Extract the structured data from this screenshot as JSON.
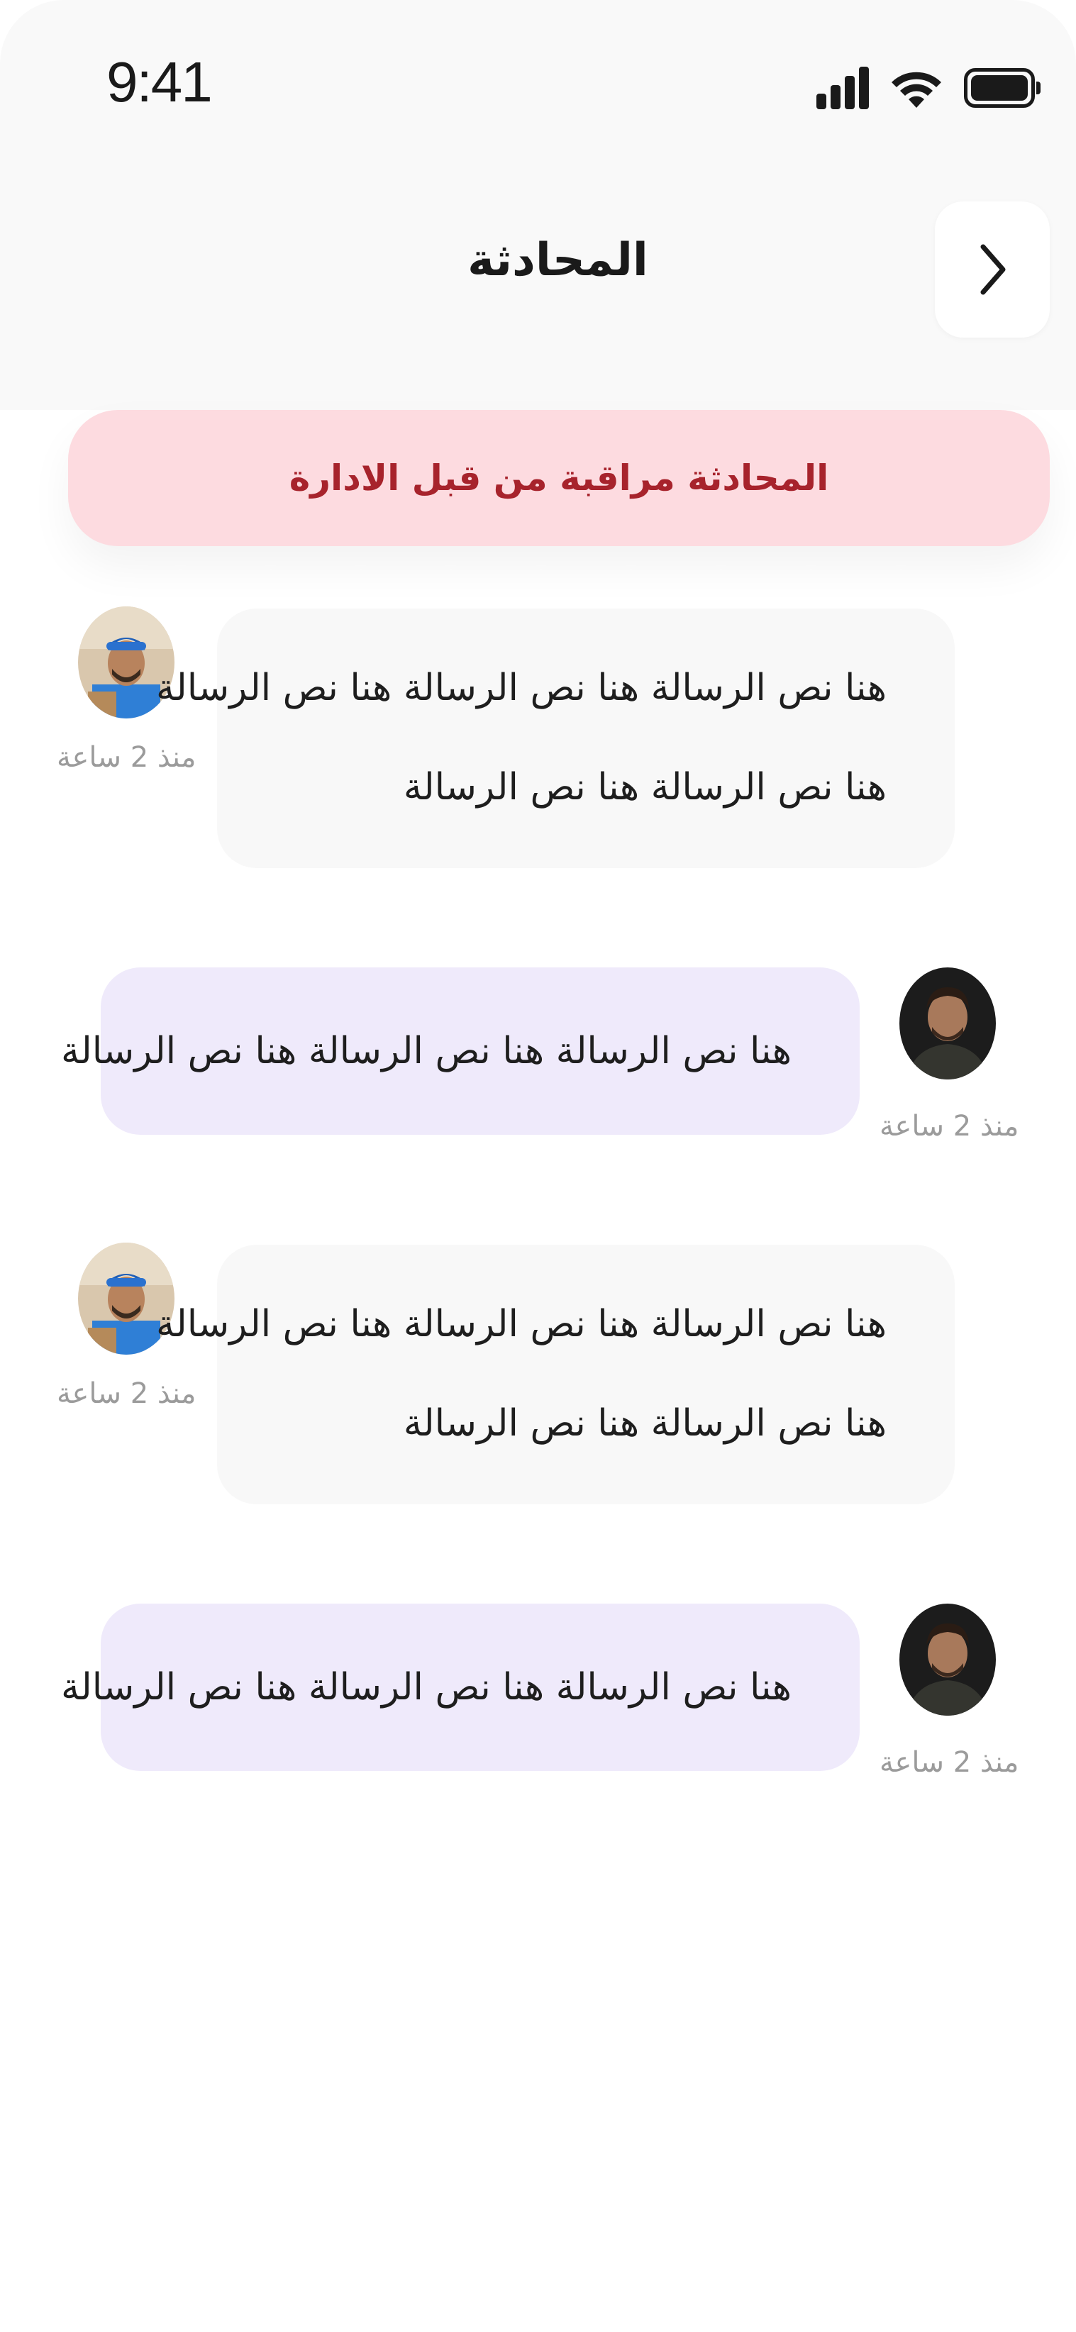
{
  "status_bar": {
    "time": "9:41",
    "icons": [
      "signal-icon",
      "wifi-icon",
      "battery-icon"
    ]
  },
  "header": {
    "title": "المحادثة",
    "back_icon": "chevron-right-icon"
  },
  "banner": {
    "text": "المحادثة مراقبة من قبل الادارة",
    "background": "#fddbe0",
    "color": "#a7232c"
  },
  "colors": {
    "received_bubble": "#f8f8f8",
    "sent_bubble": "#efeafb",
    "timestamp": "#9b9b9b"
  },
  "messages": [
    {
      "direction": "received",
      "avatar": "delivery-person-avatar",
      "lines": [
        "هنا نص الرسالة هنا نص الرسالة هنا نص الرسالة",
        "هنا نص الرسالة هنا نص الرسالة"
      ],
      "time": "منذ 2 ساعة"
    },
    {
      "direction": "sent",
      "avatar": "user-avatar",
      "lines": [
        "هنا نص الرسالة هنا نص الرسالة هنا نص الرسالة"
      ],
      "time": "منذ 2 ساعة"
    },
    {
      "direction": "received",
      "avatar": "delivery-person-avatar",
      "lines": [
        "هنا نص الرسالة هنا نص الرسالة هنا نص الرسالة",
        "هنا نص الرسالة هنا نص الرسالة"
      ],
      "time": "منذ 2 ساعة"
    },
    {
      "direction": "sent",
      "avatar": "user-avatar",
      "lines": [
        "هنا نص الرسالة هنا نص الرسالة هنا نص الرسالة"
      ],
      "time": "منذ 2 ساعة"
    }
  ]
}
